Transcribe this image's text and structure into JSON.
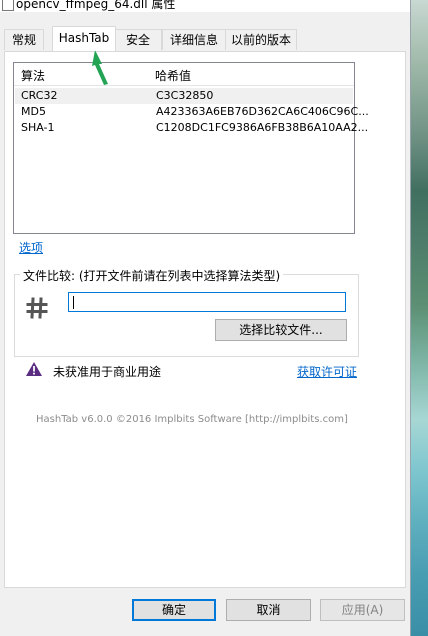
{
  "window": {
    "title": "opencv_ffmpeg_64.dll 属性"
  },
  "tabs": [
    {
      "label": "常规"
    },
    {
      "label": "HashTab"
    },
    {
      "label": "安全"
    },
    {
      "label": "详细信息"
    },
    {
      "label": "以前的版本"
    }
  ],
  "hash_table": {
    "columns": [
      "算法",
      "哈希值"
    ],
    "rows": [
      {
        "algo": "CRC32",
        "value": "C3C32850"
      },
      {
        "algo": "MD5",
        "value": "A423363A6EB76D362CA6C406C96C..."
      },
      {
        "algo": "SHA-1",
        "value": "C1208DC1FC9386A6FB38B6A10AA2..."
      }
    ]
  },
  "options_link": "选项",
  "file_compare": {
    "title": "文件比较: (打开文件前请在列表中选择算法类型)",
    "input_value": "",
    "select_button": "选择比较文件..."
  },
  "license": {
    "warning_text": "未获准用于商业用途",
    "get_license_link": "获取许可证"
  },
  "copyright": "HashTab v6.0.0 ©2016 Implbits Software [http://implbits.com]",
  "footer": {
    "ok": "确定",
    "cancel": "取消",
    "apply": "应用(A)"
  },
  "colors": {
    "accent": "#0078d7",
    "link": "#0066cc",
    "warning_icon": "#5a2d82",
    "annotation_arrow": "#23a455"
  }
}
